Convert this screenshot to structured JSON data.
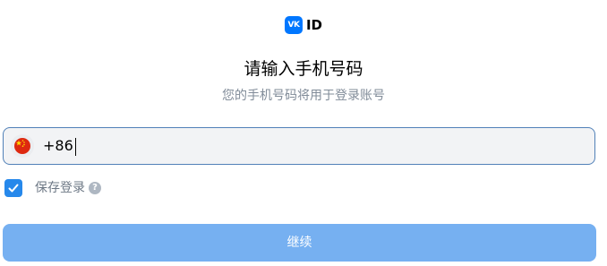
{
  "logo": {
    "badge_text": "VK",
    "text": "ID"
  },
  "header": {
    "title": "请输入手机号码",
    "subtitle": "您的手机号码将用于登录账号"
  },
  "phone": {
    "country_flag": "china-flag-icon",
    "value": "+86"
  },
  "remember": {
    "checked": true,
    "label": "保存登录",
    "help_icon": "question-circle-icon"
  },
  "continue_button": {
    "label": "继续",
    "disabled": true
  },
  "colors": {
    "brand": "#0077ff",
    "field_border": "#5181b8",
    "checkbox": "#2688eb",
    "button_disabled": "#76b0f1"
  }
}
